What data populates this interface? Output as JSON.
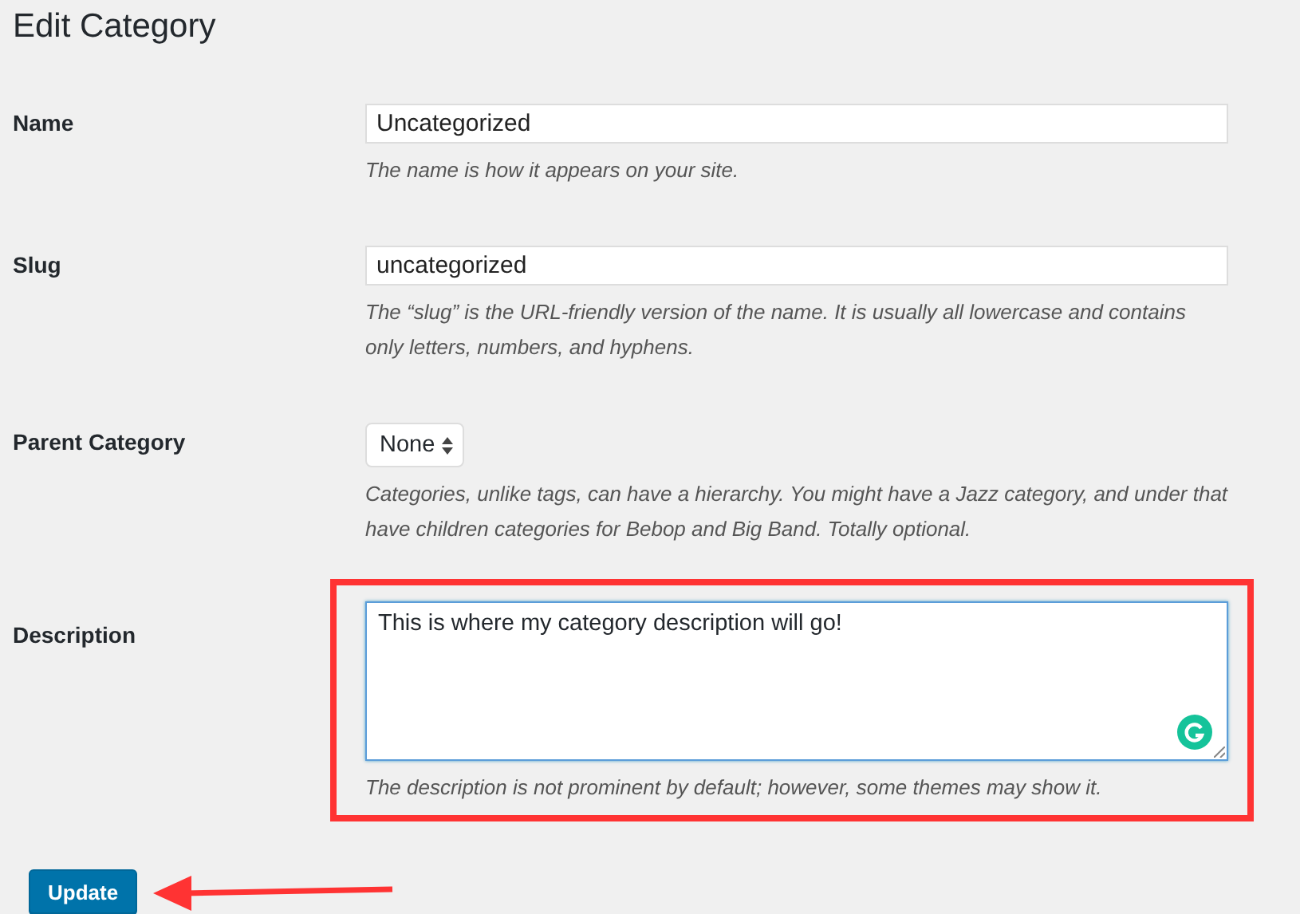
{
  "title": "Edit Category",
  "fields": [
    {
      "kind": "text",
      "label": "Name",
      "value": "Uncategorized",
      "hint": "The name is how it appears on your site.",
      "highlighted": false
    },
    {
      "kind": "text",
      "label": "Slug",
      "value": "uncategorized",
      "hint": "The “slug” is the URL-friendly version of the name. It is usually all lowercase and contains only letters, numbers, and hyphens.",
      "highlighted": false
    },
    {
      "kind": "select",
      "label": "Parent Category",
      "value": "None",
      "hint": "Categories, unlike tags, can have a hierarchy. You might have a Jazz category, and under that have children categories for Bebop and Big Band. Totally optional.",
      "highlighted": false
    },
    {
      "kind": "textarea",
      "label": "Description",
      "value": "This is where my category description will go!",
      "hint": "The description is not prominent by default; however, some themes may show it.",
      "highlighted": true
    }
  ],
  "button": "Update"
}
